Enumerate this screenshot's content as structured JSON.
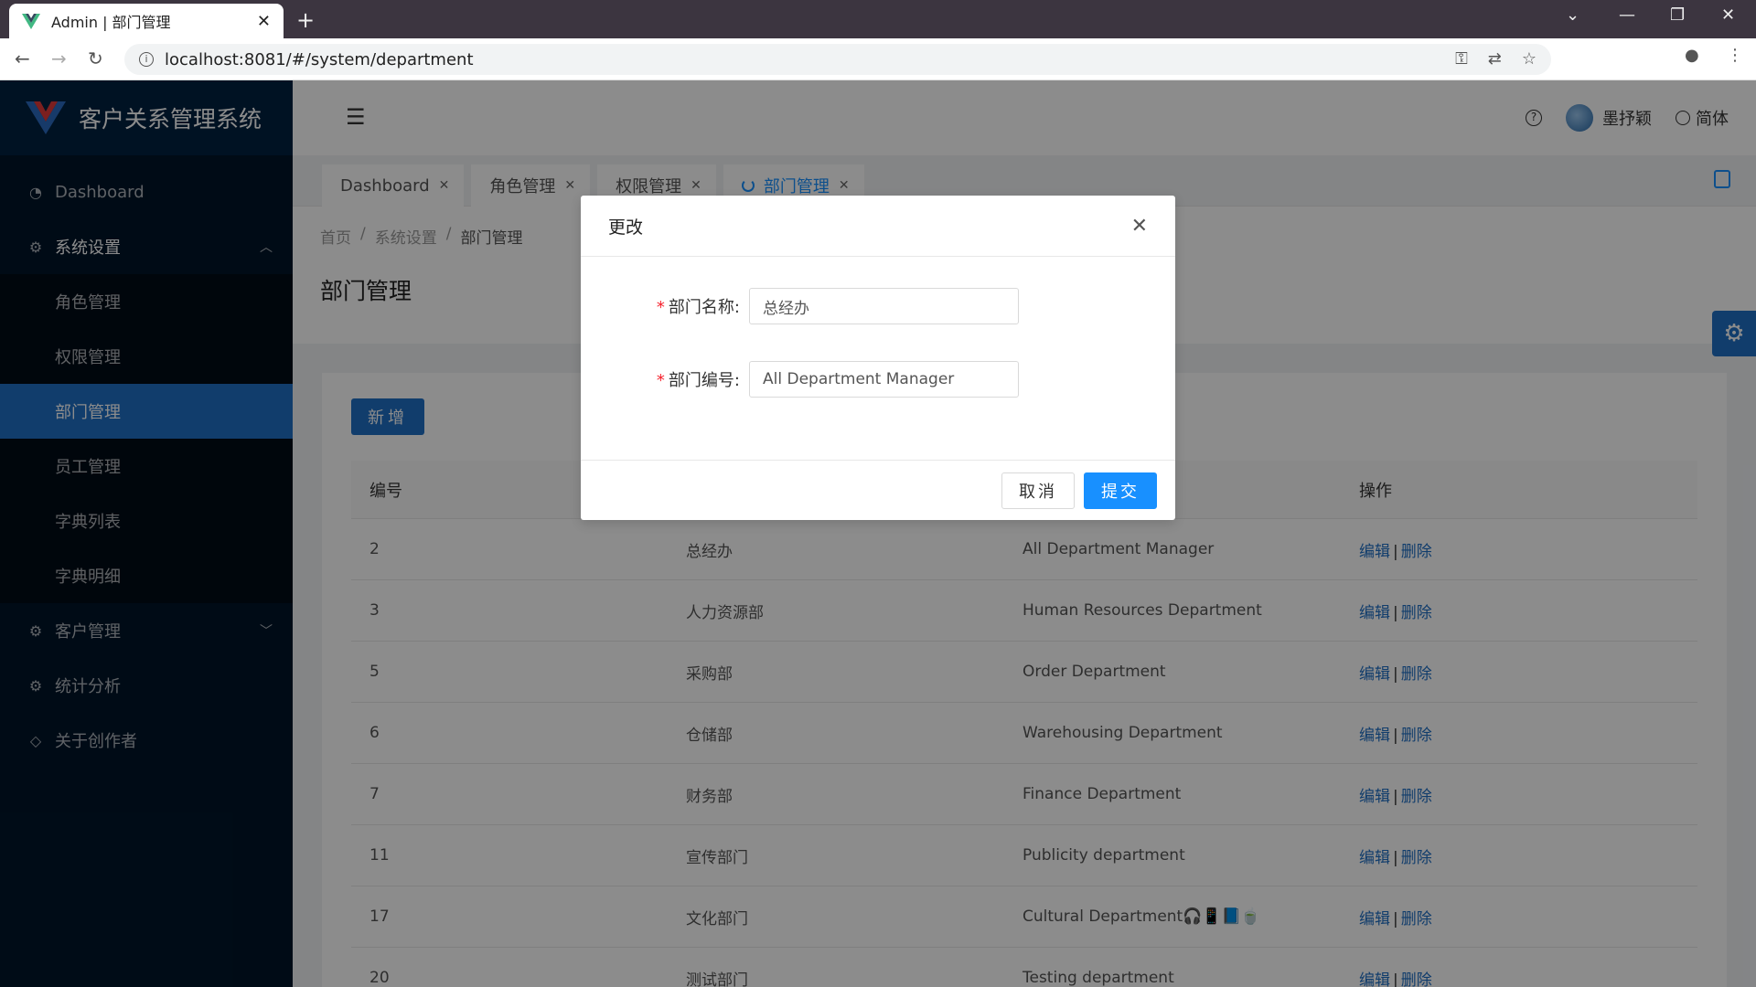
{
  "browser": {
    "tab_title": "Admin | 部门管理",
    "url": "localhost:8081/#/system/department"
  },
  "app": {
    "logo_text": "客户关系管理系统"
  },
  "sidebar": {
    "items": [
      {
        "label": "Dashboard"
      },
      {
        "label": "系统设置"
      },
      {
        "label": "角色管理"
      },
      {
        "label": "权限管理"
      },
      {
        "label": "部门管理"
      },
      {
        "label": "员工管理"
      },
      {
        "label": "字典列表"
      },
      {
        "label": "字典明细"
      },
      {
        "label": "客户管理"
      },
      {
        "label": "统计分析"
      },
      {
        "label": "关于创作者"
      }
    ]
  },
  "header": {
    "username": "墨抒颖",
    "language": "简体"
  },
  "tags": [
    {
      "label": "Dashboard"
    },
    {
      "label": "角色管理"
    },
    {
      "label": "权限管理"
    },
    {
      "label": "部门管理"
    }
  ],
  "breadcrumb": [
    "首页",
    "系统设置",
    "部门管理"
  ],
  "breadcrumb_sep": "/",
  "page_title": "部门管理",
  "add_button": "新增",
  "table": {
    "columns": [
      "编号",
      "",
      "",
      "操作"
    ],
    "edit_label": "编辑",
    "delete_label": "删除",
    "action_sep": "|",
    "rows": [
      {
        "id": "2",
        "name": "总经办",
        "sn": "All Department Manager"
      },
      {
        "id": "3",
        "name": "人力资源部",
        "sn": "Human Resources Department"
      },
      {
        "id": "5",
        "name": "采购部",
        "sn": "Order Department"
      },
      {
        "id": "6",
        "name": "仓储部",
        "sn": "Warehousing Department"
      },
      {
        "id": "7",
        "name": "财务部",
        "sn": "Finance Department"
      },
      {
        "id": "11",
        "name": "宣传部门",
        "sn": "Publicity department"
      },
      {
        "id": "17",
        "name": "文化部门",
        "sn": "Cultural Department🎧📱📘🍵"
      },
      {
        "id": "20",
        "name": "测试部门",
        "sn": "Testing department"
      }
    ]
  },
  "modal": {
    "title": "更改",
    "fields": [
      {
        "label": "部门名称:",
        "value": "总经办"
      },
      {
        "label": "部门编号:",
        "value": "All Department Manager"
      }
    ],
    "cancel_label": "取消",
    "submit_label": "提交"
  },
  "colors": {
    "sidebar_bg": "#001529",
    "primary": "#1890ff",
    "active_menu": "#1f6fc5"
  }
}
